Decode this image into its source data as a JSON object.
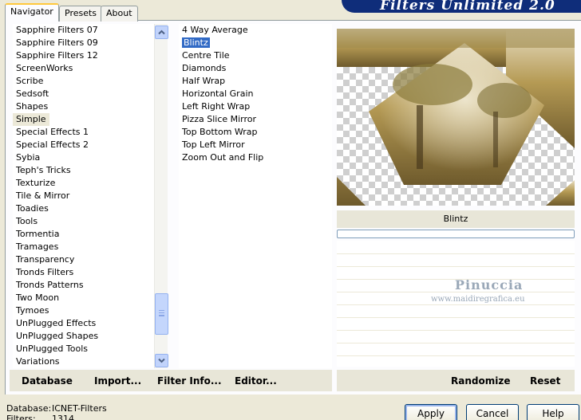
{
  "tabs": [
    "Navigator",
    "Presets",
    "About"
  ],
  "title": "Filters Unlimited 2.0",
  "categories": [
    "Sapphire Filters 07",
    "Sapphire Filters 09",
    "Sapphire Filters 12",
    "ScreenWorks",
    "Scribe",
    "Sedsoft",
    "Shapes",
    "Simple",
    "Special Effects 1",
    "Special Effects 2",
    "Sybia",
    "Teph's Tricks",
    "Texturize",
    "Tile & Mirror",
    "Toadies",
    "Tools",
    "Tormentia",
    "Tramages",
    "Transparency",
    "Tronds Filters",
    "Tronds Patterns",
    "Two Moon",
    "Tymoes",
    "UnPlugged Effects",
    "UnPlugged Shapes",
    "UnPlugged Tools",
    "Variations"
  ],
  "selected_category": "Simple",
  "filters": [
    "4 Way Average",
    "Blintz",
    "Centre Tile",
    "Diamonds",
    "Half Wrap",
    "Horizontal Grain",
    "Left Right Wrap",
    "Pizza Slice Mirror",
    "Top Bottom Wrap",
    "Top Left Mirror",
    "Zoom Out and Flip"
  ],
  "selected_filter": "Blintz",
  "preview_filter_name": "Blintz",
  "watermark": {
    "name": "Pinuccia",
    "url": "www.maidiregrafica.eu"
  },
  "commands": {
    "database": "Database",
    "import": "Import...",
    "filter_info": "Filter Info...",
    "editor": "Editor...",
    "randomize": "Randomize",
    "reset": "Reset"
  },
  "status": {
    "database_label": "Database:",
    "database_value": "ICNET-Filters",
    "filters_label": "Filters:",
    "filters_value": "1314"
  },
  "buttons": {
    "apply": "Apply",
    "cancel": "Cancel",
    "help": "Help"
  },
  "colors": {
    "selection": "#316ac5",
    "banner": "#0f2d7a",
    "dialog": "#ece9d8"
  },
  "icons": {
    "scroll_up": "chevron-up-icon",
    "scroll_down": "chevron-down-icon"
  }
}
